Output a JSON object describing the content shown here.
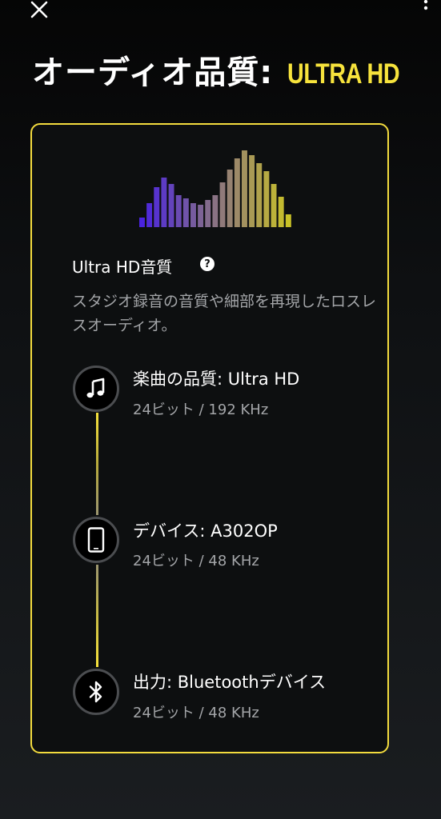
{
  "header": {
    "close_icon": "close-icon",
    "more_icon": "more-vertical-icon",
    "title": "オーディオ品質:",
    "quality_tag": "ULTRA HD"
  },
  "colors": {
    "accent": "#f7e33c",
    "background": "#121416",
    "text_secondary": "#a3a5a8",
    "equalizer_start": "#4a23e0",
    "equalizer_end": "#c9c227"
  },
  "card": {
    "section_title": "Ultra HD音質",
    "help_icon": "question-icon",
    "help_glyph": "?",
    "description": "スタジオ録音の音質や細部を再現したロスレスオーディオ。",
    "chain": [
      {
        "icon": "music-note-icon",
        "title": "楽曲の品質: Ultra HD",
        "detail": "24ビット / 192 KHz"
      },
      {
        "icon": "smartphone-icon",
        "title": "デバイス: A302OP",
        "detail": "24ビット / 48 KHz"
      },
      {
        "icon": "bluetooth-icon",
        "title": "出力: Bluetoothデバイス",
        "detail": "24ビット / 48 KHz"
      }
    ]
  }
}
